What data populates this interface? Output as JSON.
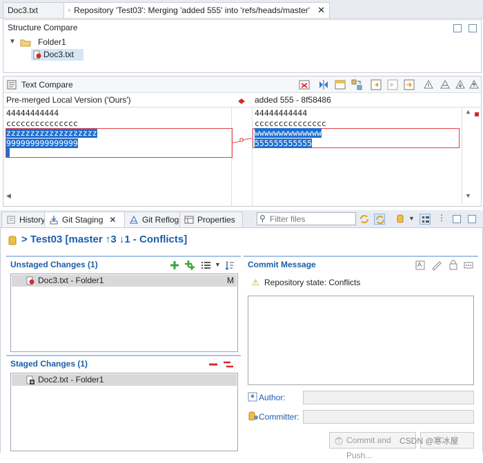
{
  "editor_tabs": {
    "tab1": "Doc3.txt",
    "tab2": "Repository 'Test03': Merging 'added 555' into 'refs/heads/master'"
  },
  "structure_compare": {
    "title": "Structure Compare",
    "folder": "Folder1",
    "file": "Doc3.txt"
  },
  "text_compare": {
    "title": "Text Compare",
    "left_header": "Pre-merged Local Version ('Ours')",
    "right_header": "added 555 - 8f58486",
    "left_lines": [
      "44444444444",
      "ccccccccccccccc",
      "zzzzzzzzzzzzzzzzzzz",
      "999999999999999",
      ""
    ],
    "right_lines": [
      "44444444444",
      "ccccccccccccccc",
      "wwwwwwwwwwwwww",
      "555555555555"
    ]
  },
  "bottom_tabs": {
    "history": "History",
    "git_staging": "Git Staging",
    "git_reflog": "Git Reflog",
    "properties": "Properties",
    "filter_placeholder": "Filter files"
  },
  "repo_header": "> Test03 [master ↑3 ↓1 - Conflicts]",
  "unstaged": {
    "title": "Unstaged Changes (1)",
    "items": [
      {
        "label": "Doc3.txt - Folder1",
        "status": "M"
      }
    ]
  },
  "staged": {
    "title": "Staged Changes (1)",
    "items": [
      {
        "label": "Doc2.txt - Folder1"
      }
    ]
  },
  "commit": {
    "title": "Commit Message",
    "repo_state": "Repository state: Conflicts",
    "author_label": "Author:",
    "committer_label": "Committer:",
    "commit_push_label": "Commit and Push...",
    "watermark": "CSDN @寒冰屋"
  }
}
